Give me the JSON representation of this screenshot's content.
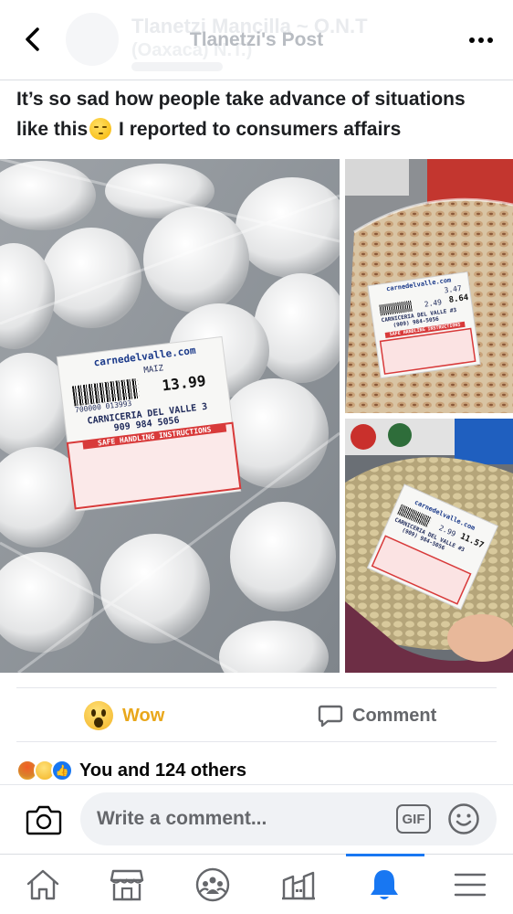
{
  "header": {
    "title": "Tlanetzi's Post",
    "ghost_name": "Tlanetzi Mancilla ~ O.N.T",
    "ghost_sub": "(Oaxaca) N.T.)",
    "back_icon": "chevron-left-icon",
    "more_icon": "more-horizontal-icon"
  },
  "post": {
    "text_before_emoji": "It’s so sad how people take advance of situations like this",
    "emoji": "unamused-face-emoji",
    "text_after_emoji": " I reported to consumers affairs",
    "photos": [
      {
        "label_site": "carnedelvalle.com",
        "label_item": "MAIZ",
        "label_price": "13.99",
        "label_barcode": "700000 013993",
        "label_store": "CARNICERIA DEL VALLE 3",
        "label_phone": "909 984 5056",
        "label_safe": "SAFE HANDLING INSTRUCTIONS"
      },
      {
        "label_site": "carnedelvalle.com",
        "label_lb": "3.47",
        "label_unit": "2.49",
        "label_price": "8.64",
        "label_store": "CARNICERIA DEL VALLE #3",
        "label_phone": "(909) 984-5056",
        "label_safe": "SAFE HANDLING INSTRUCTIONS"
      },
      {
        "label_site": "carnedelvalle.com",
        "label_unit": "2.99",
        "label_price": "11.57",
        "label_store": "CARNICERIA DEL VALLE #3",
        "label_phone": "(909) 984-5056"
      }
    ]
  },
  "actions": {
    "wow_label": "Wow",
    "comment_label": "Comment"
  },
  "reactions": {
    "icons": [
      "angry",
      "wow",
      "like"
    ],
    "summary": "You and 124 others"
  },
  "comment_bar": {
    "placeholder": "Write a comment...",
    "gif_label": "GIF"
  },
  "nav": {
    "items": [
      "home",
      "marketplace",
      "groups",
      "pages",
      "notifications",
      "menu"
    ],
    "active": "notifications"
  },
  "colors": {
    "brand_blue": "#1877f2",
    "wow_yellow": "#e9a71b",
    "secondary_text": "#65676b"
  }
}
